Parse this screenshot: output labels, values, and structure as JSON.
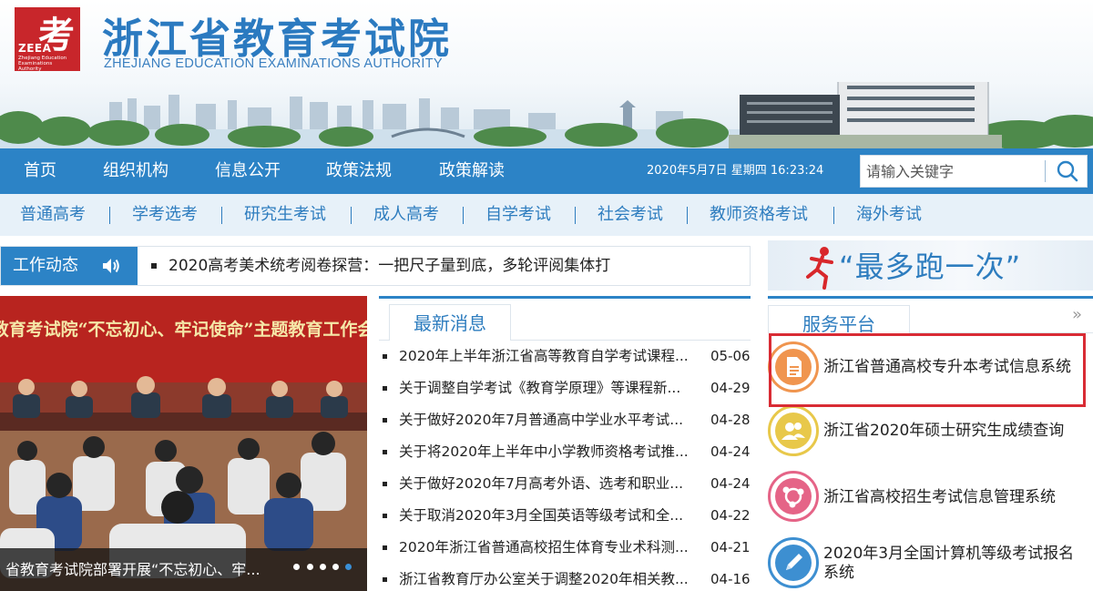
{
  "header": {
    "logo_big_char": "考",
    "logo_abbr": "ZEEA",
    "logo_small": "Zhejiang Education Examinations Authority",
    "title": "浙江省教育考试院",
    "subtitle": "ZHEJIANG EDUCATION EXAMINATIONS AUTHORITY"
  },
  "main_nav": {
    "items": [
      "首页",
      "组织机构",
      "信息公开",
      "政策法规",
      "政策解读"
    ],
    "datetime": "2020年5月7日 星期四 16:23:24"
  },
  "search": {
    "placeholder": "请输入关键字",
    "icon": "search-icon"
  },
  "sub_nav": {
    "items": [
      "普通高考",
      "学考选考",
      "研究生考试",
      "成人高考",
      "自学考试",
      "社会考试",
      "教师资格考试",
      "海外考试"
    ]
  },
  "ticker": {
    "label": "工作动态",
    "icon": "speaker-icon",
    "text": "2020高考美术统考阅卷探营：一把尺子量到底，多轮评阅集体打"
  },
  "slideshow": {
    "banner_text": "省教育考试院“不忘初心、牢记使命”主题教育工作会议",
    "caption": "省教育考试院部署开展“不忘初心、牢...",
    "dot_count": 5,
    "active_dot": 5
  },
  "news": {
    "tab_label": "最新消息",
    "rows": [
      {
        "title": "2020年上半年浙江省高等教育自学考试课程...",
        "date": "05-06"
      },
      {
        "title": "关于调整自学考试《教育学原理》等课程新...",
        "date": "04-29"
      },
      {
        "title": "关于做好2020年7月普通高中学业水平考试...",
        "date": "04-28"
      },
      {
        "title": "关于将2020年上半年中小学教师资格考试推...",
        "date": "04-24"
      },
      {
        "title": "关于做好2020年7月高考外语、选考和职业...",
        "date": "04-24"
      },
      {
        "title": "关于取消2020年3月全国英语等级考试和全...",
        "date": "04-22"
      },
      {
        "title": "2020年浙江省普通高校招生体育专业术科测...",
        "date": "04-21"
      },
      {
        "title": "浙江省教育厅办公室关于调整2020年相关教...",
        "date": "04-16"
      }
    ]
  },
  "promo": {
    "slogan": "“最多跑一次”"
  },
  "service": {
    "tab_label": "服务平台",
    "more_icon": "double-chevron-right-icon",
    "items": [
      {
        "label": "浙江省普通高校专升本考试信息系统",
        "icon": "document-icon",
        "color": "#f0954f"
      },
      {
        "label": "浙江省2020年硕士研究生成绩查询",
        "icon": "users-icon",
        "color": "#e8c84a"
      },
      {
        "label": "浙江省高校招生考试信息管理系统",
        "icon": "network-icon",
        "color": "#e56487"
      },
      {
        "label": "2020年3月全国计算机等级考试报名系统",
        "icon": "pencil-icon",
        "color": "#3d8fd1"
      }
    ]
  },
  "colors": {
    "nav_blue": "#2c83c6",
    "title_blue": "#2b7ac0",
    "highlight_red": "#d92b34"
  }
}
